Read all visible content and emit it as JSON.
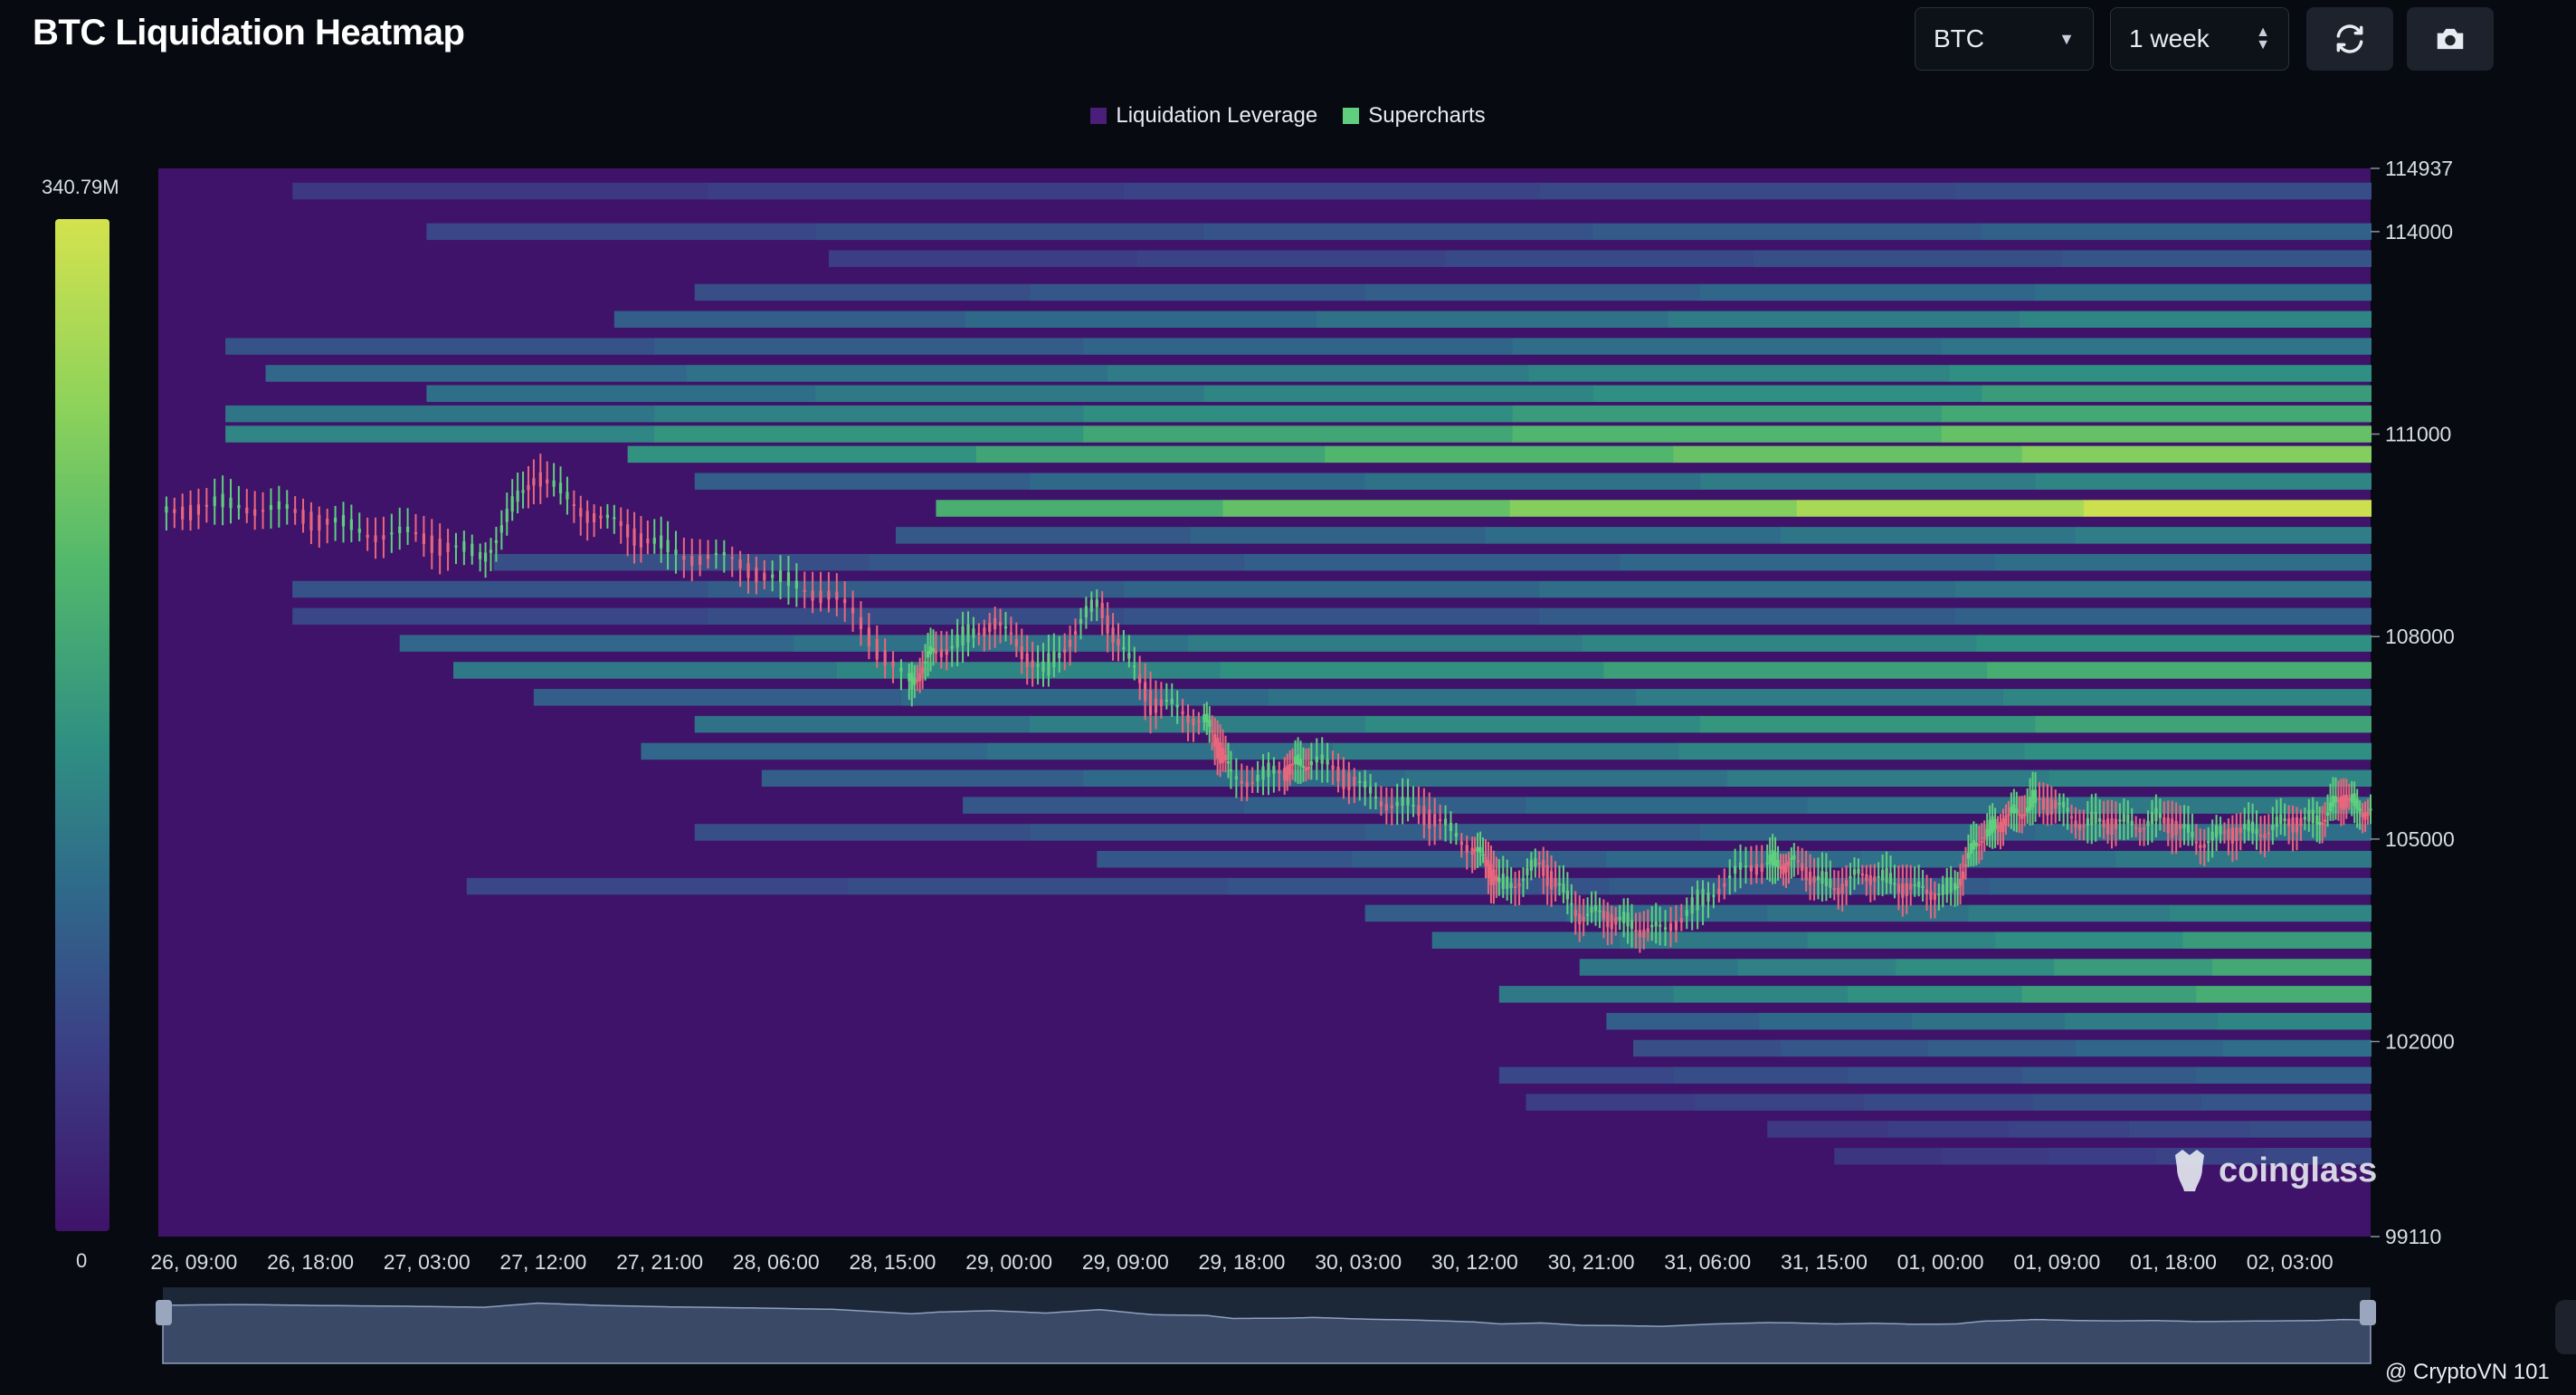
{
  "title": "BTC Liquidation Heatmap",
  "controls": {
    "coin": "BTC",
    "range": "1 week",
    "refresh_icon": "refresh-icon",
    "snapshot_icon": "camera-icon"
  },
  "legend": [
    {
      "label": "Liquidation Leverage",
      "color": "#4a1f7a"
    },
    {
      "label": "Supercharts",
      "color": "#5fcf7e"
    }
  ],
  "colorbar": {
    "max_label": "340.79M",
    "min_label": "0"
  },
  "watermark": "coinglass",
  "credit": "@ CryptoVN 101",
  "chart_data": {
    "type": "heatmap",
    "title": "BTC Liquidation Heatmap",
    "x_tick_labels": [
      "26, 09:00",
      "26, 18:00",
      "27, 03:00",
      "27, 12:00",
      "27, 21:00",
      "28, 06:00",
      "28, 15:00",
      "29, 00:00",
      "29, 09:00",
      "29, 18:00",
      "30, 03:00",
      "30, 12:00",
      "30, 21:00",
      "31, 06:00",
      "31, 15:00",
      "01, 00:00",
      "01, 09:00",
      "01, 18:00",
      "02, 03:00"
    ],
    "y_tick_labels": [
      "114937",
      "114000",
      "111000",
      "108000",
      "105000",
      "102000",
      "99110"
    ],
    "y_tick_values": [
      114937,
      114000,
      111000,
      108000,
      105000,
      102000,
      99110
    ],
    "ylim": [
      99110,
      114937
    ],
    "x_range_hours": [
      0,
      165
    ],
    "colorscale": {
      "min": 0,
      "max_label": "340.79M",
      "stops": [
        "#3f136a",
        "#3b3f86",
        "#2f6a8a",
        "#2f8f82",
        "#52b86c",
        "#8fd35a",
        "#d4e24e"
      ]
    },
    "bands": [
      {
        "price": 114600,
        "start": 10,
        "intensity": 0.22
      },
      {
        "price": 114000,
        "start": 20,
        "intensity": 0.3
      },
      {
        "price": 113600,
        "start": 50,
        "intensity": 0.25
      },
      {
        "price": 113100,
        "start": 40,
        "intensity": 0.35
      },
      {
        "price": 112700,
        "start": 34,
        "intensity": 0.45
      },
      {
        "price": 112300,
        "start": 5,
        "intensity": 0.38
      },
      {
        "price": 111900,
        "start": 8,
        "intensity": 0.5
      },
      {
        "price": 111600,
        "start": 20,
        "intensity": 0.55
      },
      {
        "price": 111300,
        "start": 5,
        "intensity": 0.6
      },
      {
        "price": 111000,
        "start": 5,
        "intensity": 0.72
      },
      {
        "price": 110700,
        "start": 35,
        "intensity": 0.8
      },
      {
        "price": 110300,
        "start": 40,
        "intensity": 0.45
      },
      {
        "price": 109900,
        "start": 58,
        "intensity": 0.98
      },
      {
        "price": 109500,
        "start": 55,
        "intensity": 0.42
      },
      {
        "price": 109100,
        "start": 25,
        "intensity": 0.35
      },
      {
        "price": 108700,
        "start": 10,
        "intensity": 0.38
      },
      {
        "price": 108300,
        "start": 10,
        "intensity": 0.3
      },
      {
        "price": 107900,
        "start": 18,
        "intensity": 0.5
      },
      {
        "price": 107500,
        "start": 22,
        "intensity": 0.62
      },
      {
        "price": 107100,
        "start": 28,
        "intensity": 0.45
      },
      {
        "price": 106700,
        "start": 40,
        "intensity": 0.58
      },
      {
        "price": 106300,
        "start": 36,
        "intensity": 0.5
      },
      {
        "price": 105900,
        "start": 45,
        "intensity": 0.45
      },
      {
        "price": 105500,
        "start": 60,
        "intensity": 0.4
      },
      {
        "price": 105100,
        "start": 40,
        "intensity": 0.35
      },
      {
        "price": 104700,
        "start": 70,
        "intensity": 0.4
      },
      {
        "price": 104300,
        "start": 23,
        "intensity": 0.3
      },
      {
        "price": 103900,
        "start": 90,
        "intensity": 0.45
      },
      {
        "price": 103500,
        "start": 95,
        "intensity": 0.55
      },
      {
        "price": 103100,
        "start": 106,
        "intensity": 0.6
      },
      {
        "price": 102700,
        "start": 100,
        "intensity": 0.62
      },
      {
        "price": 102300,
        "start": 108,
        "intensity": 0.45
      },
      {
        "price": 101900,
        "start": 110,
        "intensity": 0.35
      },
      {
        "price": 101500,
        "start": 100,
        "intensity": 0.3
      },
      {
        "price": 101100,
        "start": 102,
        "intensity": 0.25
      },
      {
        "price": 100700,
        "start": 120,
        "intensity": 0.22
      },
      {
        "price": 100300,
        "start": 125,
        "intensity": 0.2
      }
    ],
    "price_series": {
      "x": [
        0,
        6,
        12,
        18,
        24,
        28,
        33,
        38,
        44,
        50,
        56,
        58,
        62,
        66,
        70,
        74,
        78,
        80,
        84,
        86,
        90,
        94,
        98,
        100,
        103,
        106,
        109,
        112,
        116,
        120,
        122,
        125,
        128,
        131,
        134,
        136,
        138,
        140,
        143,
        146,
        149,
        152,
        155,
        158,
        161,
        163,
        165
      ],
      "close": [
        109800,
        110000,
        109700,
        109500,
        109200,
        110400,
        109700,
        109300,
        109000,
        108600,
        107300,
        107800,
        108200,
        107500,
        108500,
        107000,
        106800,
        105900,
        106000,
        106200,
        105700,
        105400,
        104900,
        104300,
        104600,
        103900,
        103800,
        103600,
        104300,
        104700,
        104600,
        104300,
        104500,
        104200,
        104300,
        105100,
        105300,
        105600,
        105300,
        105200,
        105300,
        105000,
        105100,
        105200,
        105300,
        105600,
        105400
      ]
    },
    "navigator": "overview of price series"
  }
}
